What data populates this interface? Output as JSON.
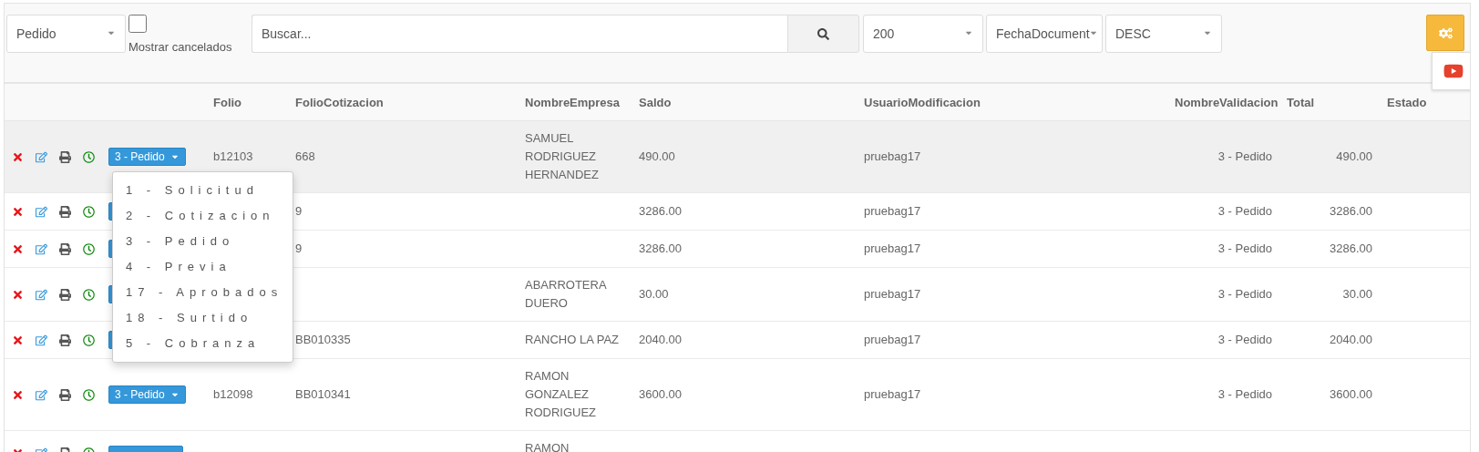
{
  "toolbar": {
    "type_select": "Pedido",
    "show_cancelled": {
      "label": "Mostrar cancelados",
      "checked": false
    },
    "search": {
      "placeholder": "Buscar..."
    },
    "page_size": "200",
    "sort_field": "FechaDocument",
    "sort_order": "DESC"
  },
  "table": {
    "columns": [
      "Folio",
      "FolioCotizacion",
      "NombreEmpresa",
      "Saldo",
      "UsuarioModificacion",
      "NombreValidacion",
      "Total",
      "Estado"
    ],
    "rows": [
      {
        "hovered": true,
        "status": "3 - Pedido",
        "folio": "b12103",
        "folio_cotizacion": "668",
        "nombre_empresa": "SAMUEL RODRIGUEZ HERNANDEZ",
        "saldo": "490.00",
        "usuario": "pruebag17",
        "validacion": "3 - Pedido",
        "total": "490.00",
        "status_menu": [
          "1 - Solicitud",
          "2 - Cotizacion",
          "3 - Pedido",
          "4 - Previa",
          "17 - Aprobados",
          "18 - Surtido",
          "5 - Cobranza"
        ]
      },
      {
        "hovered": false,
        "folio_cotizacion": "9",
        "saldo": "3286.00",
        "usuario": "pruebag17",
        "validacion": "3 - Pedido",
        "total": "3286.00"
      },
      {
        "hovered": false,
        "folio_cotizacion": "9",
        "saldo": "3286.00",
        "usuario": "pruebag17",
        "validacion": "3 - Pedido",
        "total": "3286.00"
      },
      {
        "hovered": false,
        "nombre_empresa": "ABARROTERA DUERO",
        "saldo": "30.00",
        "usuario": "pruebag17",
        "validacion": "3 - Pedido",
        "total": "30.00"
      },
      {
        "hovered": false,
        "folio_cotizacion": "BB010335",
        "nombre_empresa": "RANCHO LA PAZ",
        "saldo": "2040.00",
        "usuario": "pruebag17",
        "validacion": "3 - Pedido",
        "total": "2040.00"
      },
      {
        "hovered": false,
        "status": "3 - Pedido",
        "folio": "b12098",
        "folio_cotizacion": "BB010341",
        "nombre_empresa": "RAMON GONZALEZ RODRIGUEZ",
        "saldo": "3600.00",
        "usuario": "pruebag17",
        "validacion": "3 - Pedido",
        "total": "3600.00"
      },
      {
        "hovered": false,
        "cut": true,
        "nombre_empresa": "RAMON"
      }
    ]
  }
}
